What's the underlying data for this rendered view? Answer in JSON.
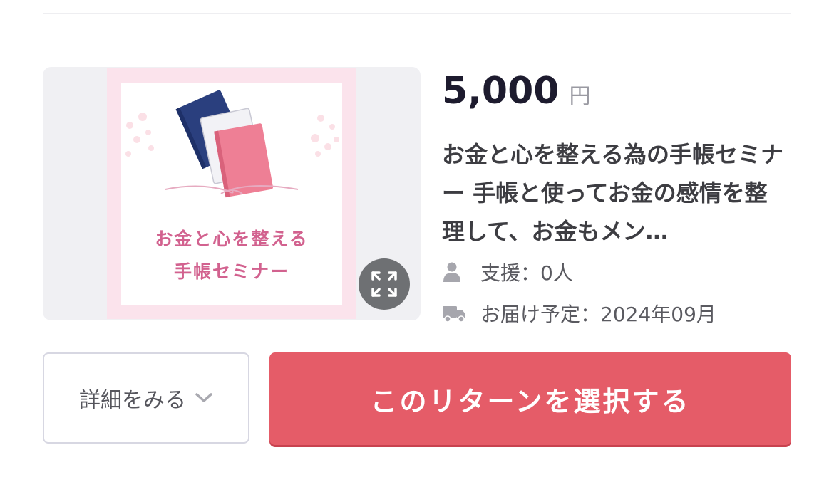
{
  "reward": {
    "price": "5,000",
    "currency": "円",
    "title": "お金と心を整える為の手帳セミナー 手帳と使ってお金の感情を整理して、お金もメン…",
    "supporters": "支援：0人",
    "delivery": "お届け予定：2024年09月",
    "thumbnail": {
      "line1": "お金と心を整える",
      "line2": "手帳セミナー"
    },
    "icons": {
      "expand": "expand-icon",
      "person": "person-icon",
      "truck": "truck-icon",
      "chevron": "chevron-down-icon"
    }
  },
  "actions": {
    "details_label": "詳細をみる",
    "select_label": "このリターンを選択する"
  },
  "colors": {
    "accent": "#e55c68",
    "thumbnail_text": "#d2628f",
    "thumbnail_frame": "#fbe3ec",
    "price_text": "#1d1b2e"
  }
}
